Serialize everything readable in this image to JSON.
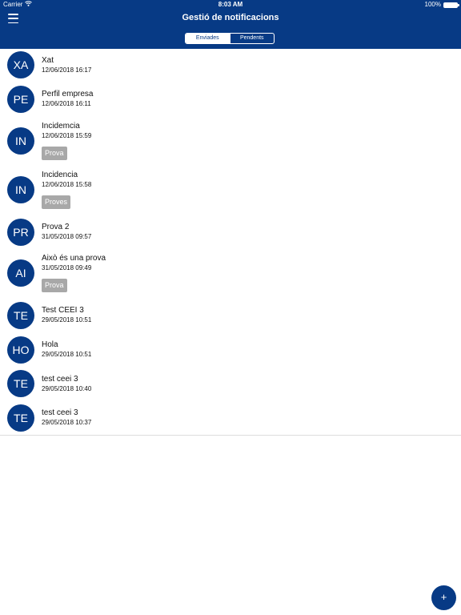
{
  "status_bar": {
    "carrier": "Carrier",
    "time": "8:03 AM",
    "battery": "100%"
  },
  "header": {
    "title": "Gestió de notificacions"
  },
  "tabs": [
    {
      "label": "Enviades",
      "active": true
    },
    {
      "label": "Pendents",
      "active": false
    }
  ],
  "notifications": [
    {
      "initials": "XA",
      "name": "Xat",
      "date": "12/06/2018 16:17",
      "tag": ""
    },
    {
      "initials": "PE",
      "name": "Perfil empresa",
      "date": "12/06/2018 16:11",
      "tag": ""
    },
    {
      "initials": "IN",
      "name": "Incidemcia",
      "date": "12/06/2018 15:59",
      "tag": "Prova"
    },
    {
      "initials": "IN",
      "name": "Incidencia",
      "date": "12/06/2018 15:58",
      "tag": "Proves"
    },
    {
      "initials": "PR",
      "name": "Prova 2",
      "date": "31/05/2018 09:57",
      "tag": ""
    },
    {
      "initials": "AI",
      "name": "Això és una prova",
      "date": "31/05/2018 09:49",
      "tag": "Prova"
    },
    {
      "initials": "TE",
      "name": "Test CEEI 3",
      "date": "29/05/2018 10:51",
      "tag": ""
    },
    {
      "initials": "HO",
      "name": "Hola",
      "date": "29/05/2018 10:51",
      "tag": ""
    },
    {
      "initials": "TE",
      "name": "test ceei 3",
      "date": "29/05/2018 10:40",
      "tag": ""
    },
    {
      "initials": "TE",
      "name": "test ceei 3",
      "date": "29/05/2018 10:37",
      "tag": ""
    }
  ],
  "fab": {
    "label": "+"
  },
  "colors": {
    "primary": "#073a85",
    "tag_bg": "#a8a8a8"
  },
  "icons": {
    "menu": "hamburger-icon",
    "wifi": "wifi-icon",
    "battery": "battery-icon",
    "add": "plus-icon"
  }
}
